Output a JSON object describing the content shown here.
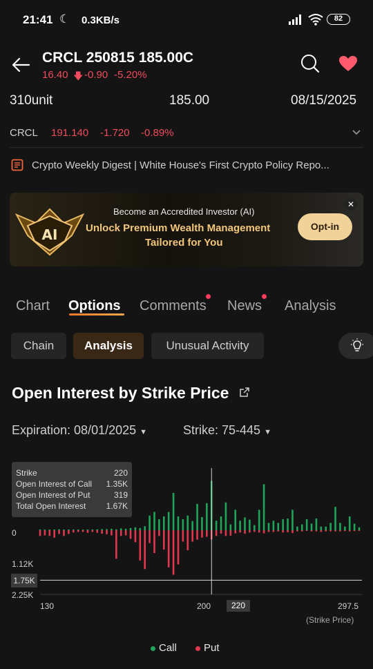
{
  "status_bar": {
    "time": "21:41",
    "speed": "0.3KB/s",
    "battery": "82"
  },
  "header": {
    "title": "CRCL 250815 185.00C",
    "price": "16.40",
    "change": "-0.90",
    "change_pct": "-5.20%"
  },
  "contract_info": {
    "unit": "310unit",
    "strike": "185.00",
    "expiry": "08/15/2025"
  },
  "underlying": {
    "symbol": "CRCL",
    "price": "191.140",
    "change": "-1.720",
    "change_pct": "-0.89%"
  },
  "news": {
    "text": "Crypto Weekly Digest | White House's First Crypto Policy Repo..."
  },
  "banner": {
    "badge": "AI",
    "line1": "Become an Accredited Investor (AI)",
    "line2": "Unlock Premium Wealth Management",
    "line3": "Tailored for You",
    "button": "Opt-in"
  },
  "tabs": [
    "Chart",
    "Options",
    "Comments",
    "News",
    "Analysis"
  ],
  "subtabs": [
    "Chain",
    "Analysis",
    "Unusual Activity"
  ],
  "section": {
    "title": "Open Interest by Strike Price",
    "expiration_label": "Expiration: 08/01/2025",
    "strike_label": "Strike: 75-445"
  },
  "tooltip": {
    "rows": [
      {
        "label": "Strike",
        "value": "220"
      },
      {
        "label": "Open Interest of Call",
        "value": "1.35K"
      },
      {
        "label": "Open Interest of Put",
        "value": "319"
      },
      {
        "label": "Total Open Interest",
        "value": "1.67K"
      }
    ]
  },
  "colors": {
    "call": "#1fa55a",
    "put": "#e0364f",
    "accent": "#f07b2a"
  },
  "chart_data": {
    "type": "bar",
    "title": "Open Interest by Strike Price",
    "xlabel": "(Strike Price)",
    "y_ticks": [
      "0",
      "1.12K",
      "1.75K",
      "2.25K"
    ],
    "x_ticks": [
      "130",
      "200",
      "220",
      "297.5"
    ],
    "highlight_strike": 220,
    "crosshair_value": "1.75K",
    "xlim": [
      130,
      297.5
    ],
    "ylim": [
      -2250,
      1700
    ],
    "legend": [
      "Call",
      "Put"
    ],
    "strikes": [
      130,
      132.5,
      135,
      137.5,
      140,
      142.5,
      145,
      147.5,
      150,
      152.5,
      155,
      157.5,
      160,
      162.5,
      165,
      167.5,
      170,
      172.5,
      175,
      177.5,
      180,
      182.5,
      185,
      187.5,
      190,
      192.5,
      195,
      197.5,
      200,
      202.5,
      205,
      207.5,
      210,
      212.5,
      215,
      217.5,
      220,
      222.5,
      225,
      227.5,
      230,
      232.5,
      235,
      237.5,
      240,
      242.5,
      245,
      247.5,
      250,
      252.5,
      255,
      257.5,
      260,
      262.5,
      265,
      267.5,
      270,
      272.5,
      275,
      277.5,
      280,
      282.5,
      285,
      287.5,
      290,
      292.5,
      295,
      297.5
    ],
    "series": [
      {
        "name": "Call",
        "values": [
          20,
          15,
          15,
          20,
          25,
          15,
          20,
          20,
          15,
          15,
          20,
          20,
          25,
          30,
          30,
          40,
          25,
          50,
          40,
          60,
          80,
          60,
          110,
          400,
          500,
          300,
          380,
          500,
          1020,
          380,
          300,
          400,
          250,
          720,
          360,
          740,
          1350,
          260,
          380,
          760,
          160,
          560,
          260,
          350,
          290,
          140,
          560,
          1260,
          200,
          260,
          200,
          300,
          320,
          560,
          100,
          160,
          300,
          180,
          320,
          100,
          100,
          200,
          640,
          200,
          100,
          380,
          180,
          80
        ]
      },
      {
        "name": "Put",
        "values": [
          200,
          180,
          200,
          260,
          130,
          200,
          130,
          80,
          60,
          60,
          90,
          60,
          90,
          120,
          140,
          180,
          1000,
          200,
          180,
          300,
          420,
          1060,
          1360,
          450,
          800,
          200,
          680,
          1300,
          1560,
          1200,
          400,
          700,
          400,
          330,
          260,
          230,
          319,
          200,
          120,
          200,
          190,
          110,
          80,
          120,
          80,
          60,
          80,
          110,
          60,
          60,
          40,
          80,
          70,
          100,
          40,
          40,
          20,
          40,
          40,
          60,
          40,
          40,
          40,
          40,
          30,
          40,
          30,
          20
        ]
      }
    ]
  },
  "legend": {
    "call": "Call",
    "put": "Put"
  }
}
